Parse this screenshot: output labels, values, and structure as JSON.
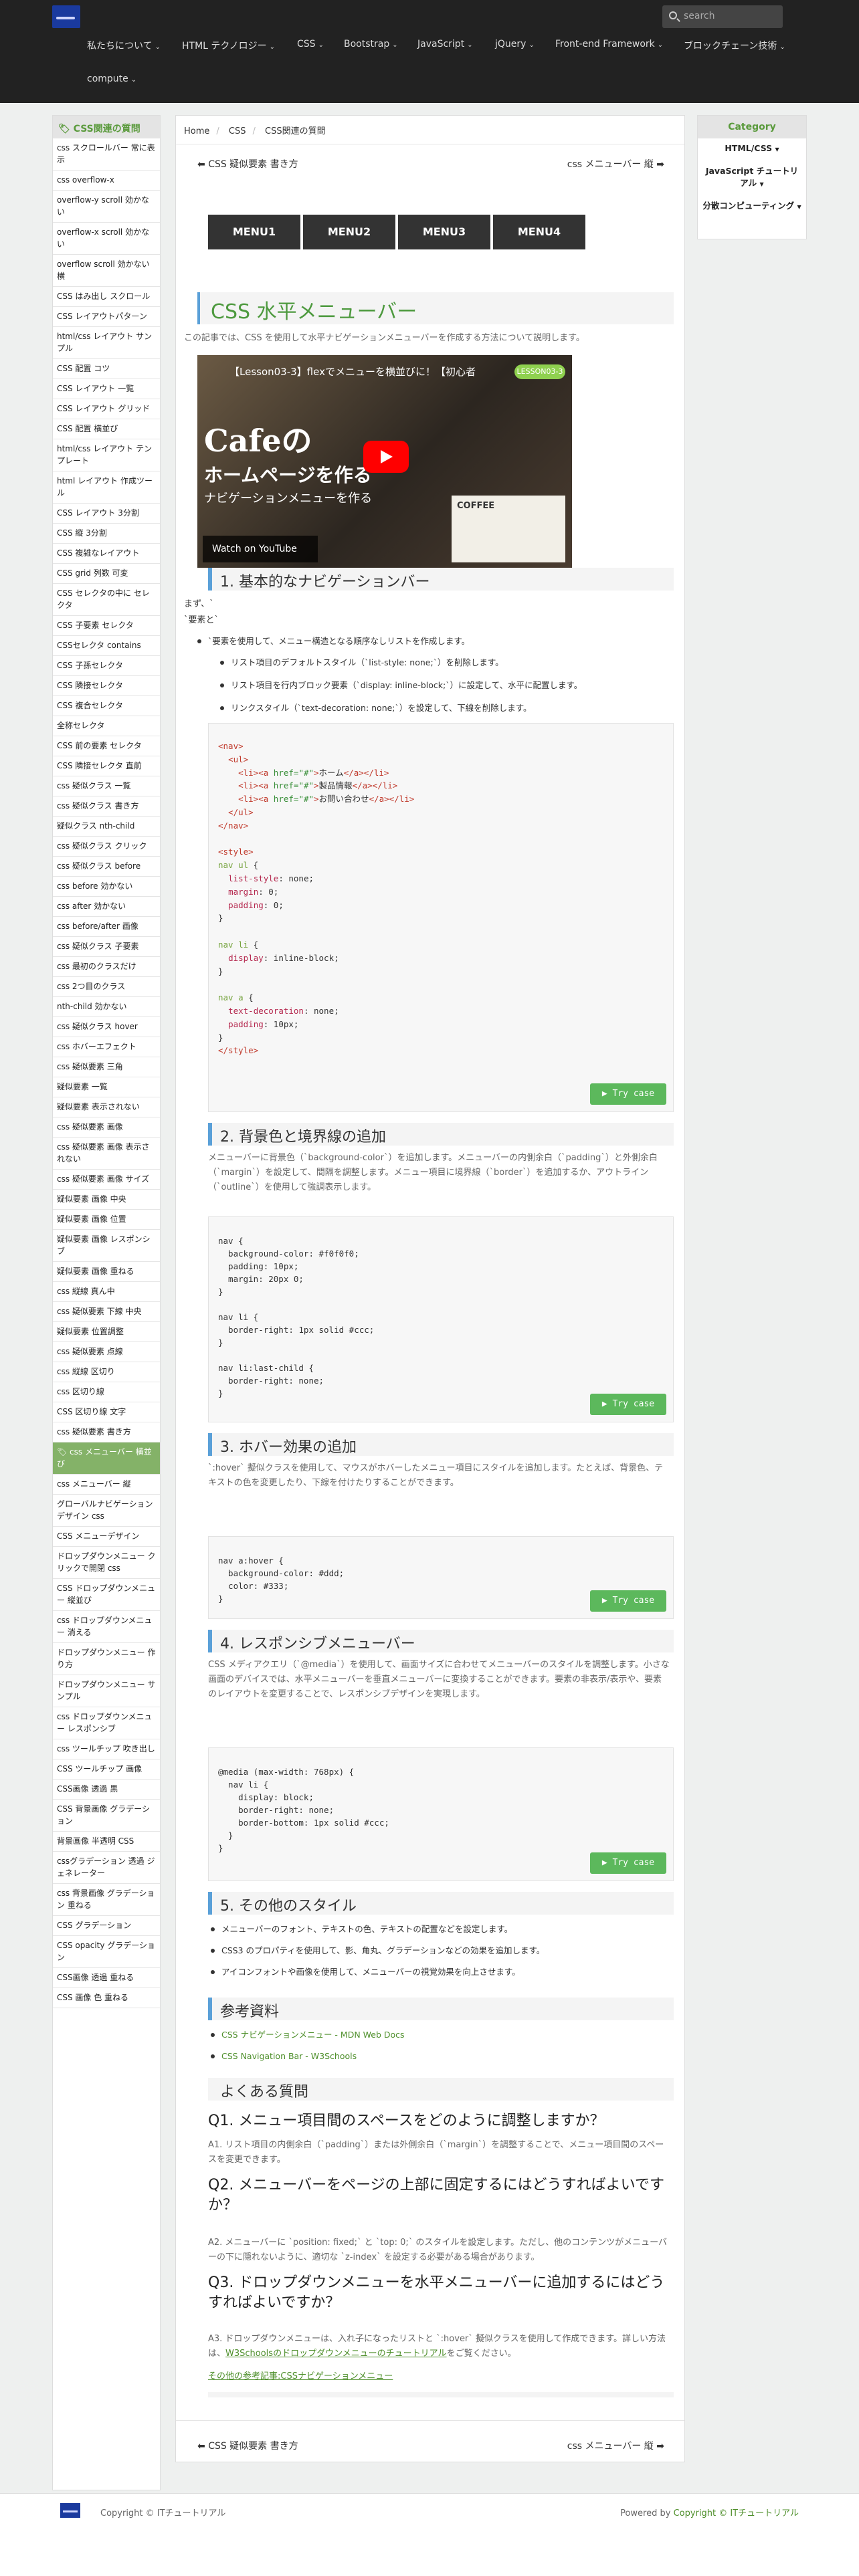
{
  "search": {
    "placeholder": "search"
  },
  "nav": [
    {
      "label": "私たちについて"
    },
    {
      "label": "HTML テクノロジー"
    },
    {
      "label": "CSS"
    },
    {
      "label": "Bootstrap"
    },
    {
      "label": "JavaScript"
    },
    {
      "label": "jQuery"
    },
    {
      "label": "Front-end Framework"
    },
    {
      "label": "ブロックチェーン技術"
    },
    {
      "label": "compute"
    }
  ],
  "left_sidebar": {
    "title": "CSS関連の質問",
    "items": [
      "css スクロールバー 常に表示",
      "css overflow-x",
      "overflow-y scroll 効かない",
      "overflow-x scroll 効かない",
      "overflow scroll 効かない 横",
      "CSS はみ出し スクロール",
      "CSS レイアウトパターン",
      "html/css レイアウト サンプル",
      "CSS 配置 コツ",
      "CSS レイアウト 一覧",
      "CSS レイアウト グリッド",
      "CSS 配置 横並び",
      "html/css レイアウト テンプレート",
      "html レイアウト 作成ツール",
      "CSS レイアウト 3分割",
      "CSS 縦 3分割",
      "CSS 複雑なレイアウト",
      "CSS grid 列数 可変",
      "CSS セレクタの中に セレクタ",
      "CSS 子要素 セレクタ",
      "CSSセレクタ contains",
      "CSS 子孫セレクタ",
      "CSS 隣接セレクタ",
      "CSS 複合セレクタ",
      "全称セレクタ",
      "CSS 前の要素 セレクタ",
      "CSS 隣接セレクタ 直前",
      "css 疑似クラス 一覧",
      "css 疑似クラス 書き方",
      "疑似クラス nth-child",
      "css 疑似クラス クリック",
      "css 疑似クラス before",
      "css before 効かない",
      "css after 効かない",
      "css before/after 画像",
      "css 疑似クラス 子要素",
      "css 最初のクラスだけ",
      "css 2つ目のクラス",
      "nth-child 効かない",
      "css 疑似クラス hover",
      "css ホバーエフェクト",
      "css 疑似要素 三角",
      "疑似要素 一覧",
      "疑似要素 表示されない",
      "css 疑似要素 画像",
      "css 疑似要素 画像 表示されない",
      "css 疑似要素 画像 サイズ",
      "疑似要素 画像 中央",
      "疑似要素 画像 位置",
      "疑似要素 画像 レスポンシブ",
      "疑似要素 画像 重ねる",
      "css 縦線 真ん中",
      "css 疑似要素 下線 中央",
      "疑似要素 位置調整",
      "css 疑似要素 点線",
      "css 縦線 区切り",
      "css 区切り線",
      "CSS 区切り線 文字",
      "css 疑似要素 書き方",
      "css メニューバー 横並び",
      "css メニューバー 縦",
      "グローバルナビゲーション デザイン css",
      "CSS メニューデザイン",
      "ドロップダウンメニュー クリックで開閉 css",
      "CSS ドロップダウンメニュー 縦並び",
      "css ドロップダウンメニュー 消える",
      "ドロップダウンメニュー 作り方",
      "ドロップダウンメニュー サンプル",
      "css ドロップダウンメニュー レスポンシブ",
      "css ツールチップ 吹き出し",
      "CSS ツールチップ 画像",
      "CSS画像 透過 黒",
      "CSS 背景画像 グラデーション",
      "背景画像 半透明 CSS",
      "cssグラデーション 透過 ジェネレーター",
      "css 背景画像 グラデーション 重ねる",
      "CSS グラデーション",
      "CSS opacity グラデーション",
      "CSS画像 透過 重ねる",
      "CSS 画像 色 重ねる"
    ],
    "active": "css メニューバー 横並び"
  },
  "right_sidebar": {
    "title": "Category",
    "items": [
      "HTML/CSS",
      "JavaScript チュートリアル",
      "分散コンピューティング"
    ]
  },
  "breadcrumb": [
    "Home",
    "CSS",
    "CSS関連の質問"
  ],
  "pager": {
    "prev": "CSS 疑似要素 書き方",
    "next": "css メニューバー 縦"
  },
  "demo_menu": [
    "MENU1",
    "MENU2",
    "MENU3",
    "MENU4"
  ],
  "article": {
    "title": "CSS 水平メニューバー",
    "intro": "この記事では、CSS を使用して水平ナビゲーションメニューバーを作成する方法について説明します。",
    "video": {
      "title": "【Lesson03-3】flexでメニューを横並びに！【初心者",
      "badge": "LESSON03-3",
      "big": "Cafeの",
      "sub": "ホームページを作る",
      "sub2": "ナビゲーションメニューを作る",
      "coffee": "COFFEE",
      "watch": "Watch on  YouTube"
    },
    "s1": {
      "title": "1. 基本的なナビゲーションバー",
      "p1": "まず、`",
      "p2": "`要素と`",
      "lead": "`要素を使用して、メニュー構造となる順序なしリストを作成します。",
      "items": [
        "リスト項目のデフォルトスタイル（`list-style: none;`）を削除します。",
        "リスト項目を行内ブロック要素（`display: inline-block;`）に設定して、水平に配置します。",
        "リンクスタイル（`text-decoration: none;`）を設定して、下線を削除します。"
      ]
    },
    "s2": {
      "title": "2. 背景色と境界線の追加",
      "p": "メニューバーに背景色（`background-color`）を追加します。メニューバーの内側余白（`padding`）と外側余白（`margin`）を設定して、間隔を調整します。メニュー項目に境界線（`border`）を追加するか、アウトライン（`outline`）を使用して強調表示します。",
      "code": "nav {\n  background-color: #f0f0f0;\n  padding: 10px;\n  margin: 20px 0;\n}\n\nnav li {\n  border-right: 1px solid #ccc;\n}\n\nnav li:last-child {\n  border-right: none;\n}"
    },
    "s3": {
      "title": "3. ホバー効果の追加",
      "p": "`:hover` 擬似クラスを使用して、マウスがホバーしたメニュー項目にスタイルを追加します。たとえば、背景色、テキストの色を変更したり、下線を付けたりすることができます。",
      "code": "nav a:hover {\n  background-color: #ddd;\n  color: #333;\n}"
    },
    "s4": {
      "title": "4. レスポンシブメニューバー",
      "p": "CSS メディアクエリ（`@media`）を使用して、画面サイズに合わせてメニューバーのスタイルを調整します。小さな画面のデバイスでは、水平メニューバーを垂直メニューバーに変換することができます。要素の非表示/表示や、要素のレイアウトを変更することで、レスポンシブデザインを実現します。",
      "code": "@media (max-width: 768px) {\n  nav li {\n    display: block;\n    border-right: none;\n    border-bottom: 1px solid #ccc;\n  }\n}"
    },
    "s5": {
      "title": "5. その他のスタイル",
      "items": [
        "メニューバーのフォント、テキストの色、テキストの配置などを設定します。",
        "CSS3 のプロパティを使用して、影、角丸、グラデーションなどの効果を追加します。",
        "アイコンフォントや画像を使用して、メニューバーの視覚効果を向上させます。"
      ]
    },
    "refs": {
      "title": "参考資料",
      "items": [
        "CSS ナビゲーションメニュー - MDN Web Docs",
        "CSS Navigation Bar - W3Schools"
      ]
    },
    "faq": {
      "title": "よくある質問",
      "q1": "Q1. メニュー項目間のスペースをどのように調整しますか？",
      "a1": "A1. リスト項目の内側余白（`padding`）または外側余白（`margin`）を調整することで、メニュー項目間のスペースを変更できます。",
      "q2": "Q2. メニューバーをページの上部に固定するにはどうすればよいですか？",
      "a2": "A2. メニューバーに `position: fixed;` と `top: 0;` のスタイルを設定します。ただし、他のコンテンツがメニューバーの下に隠れないように、適切な `z-index` を設定する必要がある場合があります。",
      "q3": "Q3. ドロップダウンメニューを水平メニューバーに追加するにはどうすればよいですか？",
      "a3a": "A3. ドロップダウンメニューは、入れ子になったリストと `:hover` 擬似クラスを使用して作成できます。詳しい方法は、",
      "a3link": "W3Schoolsのドロップダウンメニューのチュートリアル",
      "a3b": "をご覧ください。",
      "more": "その他の参考記事:CSSナビゲーションメニュー"
    },
    "try_label": "Try case"
  },
  "footer": {
    "copyright": "Copyright © ITチュートリアル",
    "powered_prefix": "Powered by ",
    "powered_link": "Copyright © ITチュートリアル"
  }
}
